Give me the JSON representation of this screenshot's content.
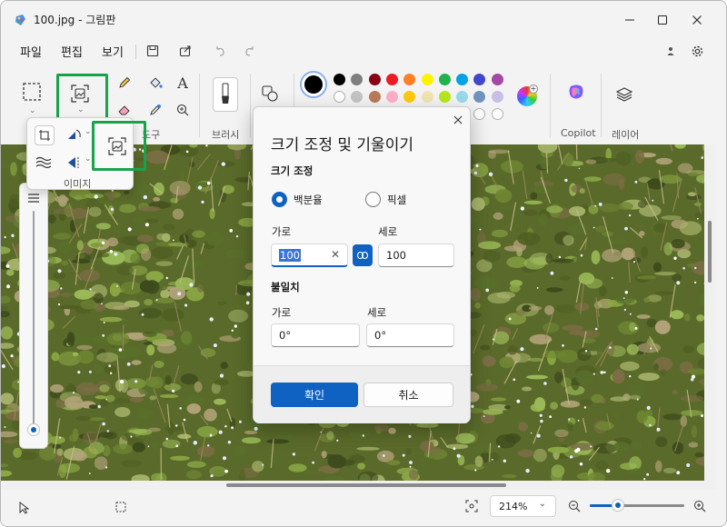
{
  "window": {
    "title": "100.jpg - 그림판"
  },
  "menu": {
    "file": "파일",
    "edit": "편집",
    "view": "보기"
  },
  "ribbon": {
    "tools_label": "도구",
    "brushes_label": "브러시",
    "image_label": "이미지",
    "copilot_label": "Copilot",
    "layers_label": "레이어",
    "text_tool_glyph": "A"
  },
  "palette": {
    "active": "#000000",
    "row1": [
      "#000000",
      "#7f7f7f",
      "#880015",
      "#ed1c24",
      "#ff7f27",
      "#fff200",
      "#22b14c",
      "#00a2e8",
      "#3f48cc",
      "#a349a4"
    ],
    "row2": [
      "#ffffff",
      "#c3c3c3",
      "#b97a57",
      "#ffaec9",
      "#ffc90e",
      "#efe4b0",
      "#b5e61d",
      "#99d9ea",
      "#7092be",
      "#c8bfe7"
    ],
    "row3_empty": 7
  },
  "dialog": {
    "title": "크기 조정 및 기울이기",
    "resize_section": "크기 조정",
    "percent_label": "백분율",
    "pixel_label": "픽셀",
    "selected_unit": "백분율",
    "horizontal_label": "가로",
    "vertical_label": "세로",
    "resize_horizontal": "100",
    "resize_vertical": "100",
    "aspect_locked": true,
    "skew_section": "불일치",
    "skew_horizontal_label": "가로",
    "skew_vertical_label": "세로",
    "skew_horizontal": "0°",
    "skew_vertical": "0°",
    "ok_label": "확인",
    "cancel_label": "취소"
  },
  "status": {
    "zoom": "214%"
  },
  "colors": {
    "accent": "#0f62c2",
    "highlight": "#18a34a",
    "grass_dark": "#3d4a1c",
    "grass_light": "#8ba845"
  }
}
